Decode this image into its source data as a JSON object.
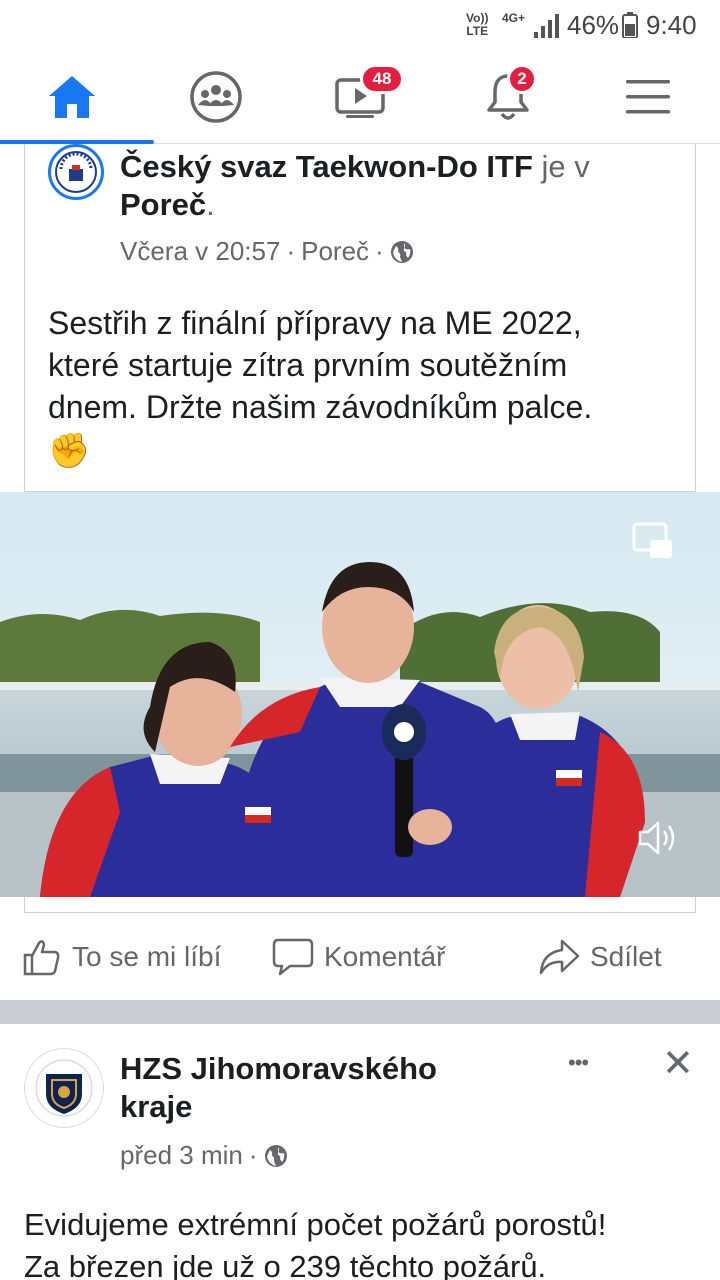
{
  "status_bar": {
    "volte_top": "Vo))",
    "volte_bottom": "LTE",
    "network": "4G+",
    "battery_percent": "46%",
    "time": "9:40"
  },
  "nav": {
    "tabs": [
      {
        "icon": "home-icon",
        "active": true
      },
      {
        "icon": "groups-icon"
      },
      {
        "icon": "video-icon",
        "badge": "48"
      },
      {
        "icon": "bell-icon",
        "badge": "2"
      },
      {
        "icon": "menu-icon"
      }
    ],
    "accent": "#1877f2"
  },
  "post1": {
    "author": "Český svaz Taekwon-Do ITF",
    "connector": "je v",
    "location_bold": "Poreč",
    "location_suffix": ".",
    "time": "Včera v 20:57",
    "place": "Poreč",
    "text_lines": [
      "Sestřih z finální přípravy na ME 2022,",
      "které startuje zítra prvním soutěžním",
      "dnem. Držte našim závodníkům palce."
    ],
    "emoji": "✊",
    "actions": {
      "like": "To se mi líbí",
      "comment": "Komentář",
      "share": "Sdílet"
    }
  },
  "post2": {
    "author_line1": "HZS Jihomoravského",
    "author_line2": "kraje",
    "time": "před 3 min",
    "more": "•••",
    "close": "✕",
    "text_lines": [
      "Evidujeme extrémní počet požárů porostů!",
      "Za březen jde už o 239 těchto požárů."
    ]
  }
}
